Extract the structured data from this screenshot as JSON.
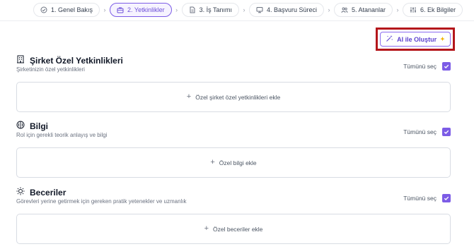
{
  "steps": [
    {
      "label": "1. Genel Bakış",
      "icon": "check-circle-icon"
    },
    {
      "label": "2. Yetkinlikler",
      "icon": "briefcase-icon",
      "active": true
    },
    {
      "label": "3. İş Tanımı",
      "icon": "document-icon"
    },
    {
      "label": "4. Başvuru Süreci",
      "icon": "monitor-icon"
    },
    {
      "label": "5. Atananlar",
      "icon": "users-icon"
    },
    {
      "label": "6. Ek Bilgiler",
      "icon": "sliders-icon"
    }
  ],
  "ai_button": {
    "label": "AI ile Oluştur"
  },
  "sections": [
    {
      "title": "Şirket Özel Yetkinlikleri",
      "subtitle": "Şirketinizin özel yetkinlikleri",
      "select_all": "Tümünü seç",
      "add_label": "Özel şirket özel yetkinlikleri ekle",
      "icon": "building-icon"
    },
    {
      "title": "Bilgi",
      "subtitle": "Rol için gerekli teorik anlayış ve bilgi",
      "select_all": "Tümünü seç",
      "add_label": "Özel bilgi ekle",
      "icon": "brain-icon"
    },
    {
      "title": "Beceriler",
      "subtitle": "Görevleri yerine getirmek için gereken pratik yetenekler ve uzmanlık",
      "select_all": "Tümünü seç",
      "add_label": "Özel beceriler ekle",
      "icon": "lightbulb-icon"
    }
  ],
  "colors": {
    "accent": "#7c5ce6",
    "highlight": "#b4161b"
  }
}
